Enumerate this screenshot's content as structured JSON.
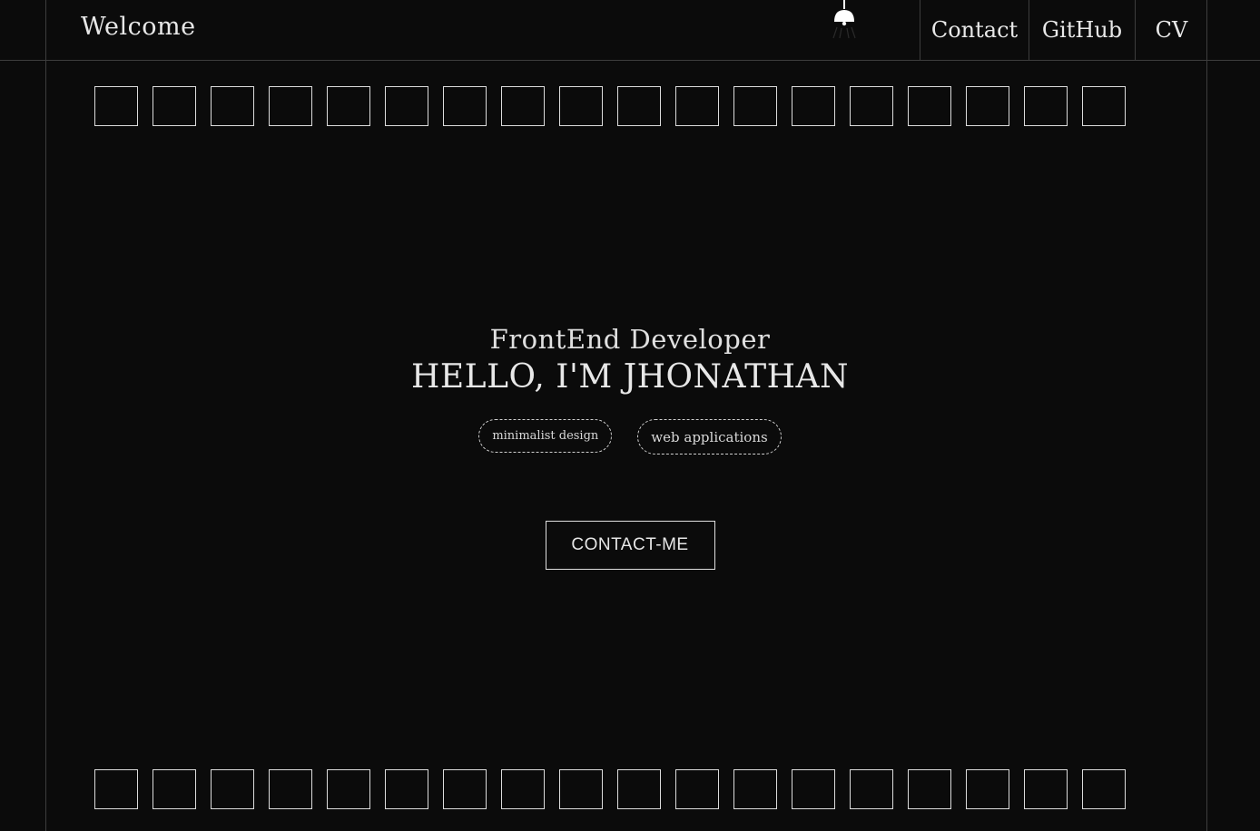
{
  "header": {
    "brand": "Welcome",
    "nav": [
      {
        "label": "Contact"
      },
      {
        "label": "GitHub"
      },
      {
        "label": "CV"
      }
    ]
  },
  "hero": {
    "subtitle": "FrontEnd Developer",
    "title": "HELLO, I'M JHONATHAN",
    "tags": [
      "minimalist design",
      "web applications"
    ],
    "cta_label": "CONTACT-ME"
  },
  "decor": {
    "lamp_icon": "lamp-icon",
    "square_rows": 2,
    "squares_per_row": 18
  },
  "colors": {
    "background": "#0b0b0b",
    "foreground": "#e6e6e6",
    "grid_line": "#3d3d3d"
  }
}
